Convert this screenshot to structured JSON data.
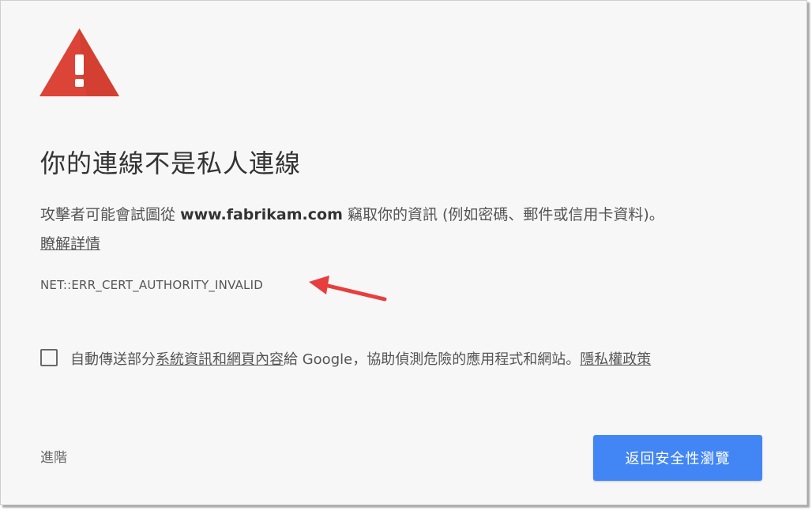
{
  "icons": {
    "warning": "warning-triangle-icon",
    "arrow": "red-arrow-annotation"
  },
  "colors": {
    "warning_red": "#db4437",
    "button_blue": "#4285f4",
    "arrow_red": "#e83e3e"
  },
  "interstitial": {
    "heading": "你的連線不是私人連線",
    "message_prefix": "攻擊者可能會試圖從",
    "domain": "www.fabrikam.com",
    "message_suffix": "竊取你的資訊 (例如密碼、郵件或信用卡資料)。",
    "learn_more": "瞭解詳情",
    "error_code": "NET::ERR_CERT_AUTHORITY_INVALID"
  },
  "report": {
    "text_before": "自動傳送部分",
    "link_system_info": "系統資訊和網頁內容",
    "text_middle": "給 Google，協助偵測危險的應用程式和網站。",
    "link_privacy": "隱私權政策"
  },
  "footer": {
    "advanced_label": "進階",
    "back_button_label": "返回安全性瀏覽"
  }
}
